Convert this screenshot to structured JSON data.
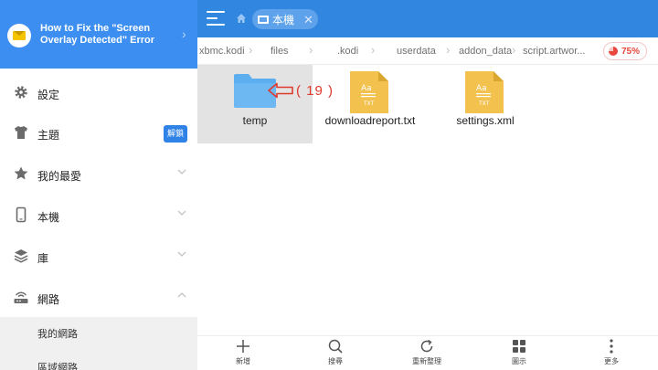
{
  "drawer": {
    "header": {
      "title": "How to Fix the \"Screen Overlay Detected\" Error",
      "icon": "mail-envelope-icon"
    },
    "items": [
      {
        "label": "設定",
        "icon": "gear-icon"
      },
      {
        "label": "主題",
        "icon": "shirt-icon",
        "badge": "解鎖"
      },
      {
        "label": "我的最愛",
        "icon": "star-icon"
      },
      {
        "label": "本機",
        "icon": "phone-icon"
      },
      {
        "label": "庫",
        "icon": "layers-icon"
      },
      {
        "label": "網路",
        "icon": "router-icon"
      }
    ],
    "sub_items": [
      {
        "label": "我的網路"
      },
      {
        "label": "區域網路"
      }
    ]
  },
  "topbar": {
    "tab_label": "本機",
    "accent": "#3187e0"
  },
  "breadcrumb": [
    "xbmc.kodi",
    "files",
    ".kodi",
    "userdata",
    "addon_data",
    "script.artwor..."
  ],
  "storage": {
    "percent_label": "75%",
    "used_fraction": 0.75,
    "color": "#e8483e"
  },
  "files": [
    {
      "name": "temp",
      "type": "folder",
      "selected": true
    },
    {
      "name": "downloadreport.txt",
      "type": "txt",
      "icon_text": "Aa",
      "icon_ext": "TXT"
    },
    {
      "name": "settings.xml",
      "type": "txt",
      "icon_text": "Aa",
      "icon_ext": "TXT"
    }
  ],
  "annotation": {
    "text": "( 19 )",
    "color": "#e03a2e"
  },
  "toolbar": [
    {
      "label": "新增",
      "icon": "plus-icon"
    },
    {
      "label": "搜尋",
      "icon": "search-icon"
    },
    {
      "label": "重新整理",
      "icon": "refresh-icon"
    },
    {
      "label": "圖示",
      "icon": "grid-icon"
    },
    {
      "label": "更多",
      "icon": "more-vertical-icon"
    }
  ]
}
